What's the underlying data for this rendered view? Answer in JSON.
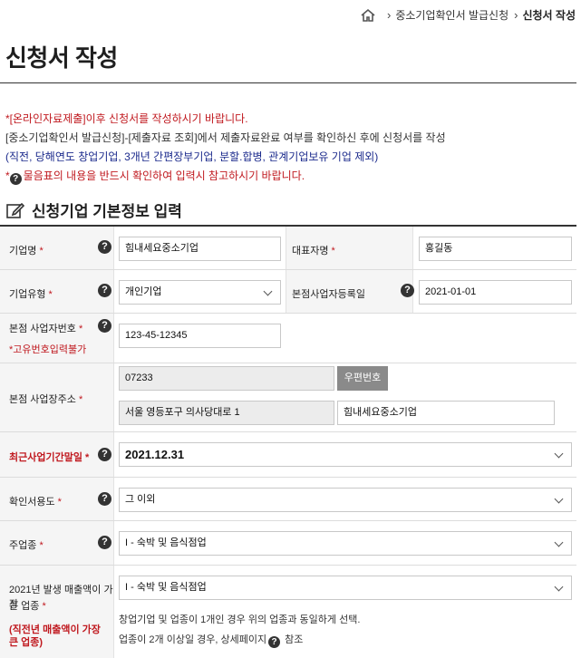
{
  "breadcrumb": {
    "items": [
      "중소기업확인서 발급신청",
      "신청서 작성"
    ]
  },
  "page": {
    "title": "신청서 작성"
  },
  "notices": {
    "line1": "*[온라인자료제출]이후 신청서를 작성하시기 바랍니다.",
    "line2": "[중소기업확인서 발급신청]-[제출자료 조회]에서 제출자료완료 여부를 확인하신 후에 신청서를 작성",
    "line3": "(직전, 당해연도 창업기업, 3개년 간편장부기업, 분할.합병, 관계기업보유 기업 제외)",
    "line4_prefix": "*",
    "line4": "물음표의 내용을 반드시 확인하여 입력시 참고하시기 바랍니다."
  },
  "section": {
    "title": "신청기업 기본정보 입력"
  },
  "form": {
    "company_name": {
      "label": "기업명",
      "value": "힘내세요중소기업"
    },
    "ceo": {
      "label": "대표자명",
      "value": "홍길동"
    },
    "company_type": {
      "label": "기업유형",
      "value": "개인기업"
    },
    "hq_reg_date": {
      "label": "본점사업자등록일",
      "value": "2021-01-01"
    },
    "hq_biz_no": {
      "label": "본점 사업자번호",
      "sub": "*고유번호입력불가",
      "value": "123-45-12345"
    },
    "hq_address": {
      "label": "본점 사업장주소",
      "zip": "07233",
      "zip_button": "우편번호",
      "address1": "서울 영등포구 의사당대로 1",
      "address2": "힘내세요중소기업"
    },
    "fiscal_end": {
      "label": "최근사업기간말일",
      "value": "2021.12.31"
    },
    "purpose": {
      "label": "확인서용도",
      "value": "그 이외"
    },
    "main_industry": {
      "label": "주업종",
      "value": "I - 숙박 및 음식점업"
    },
    "largest_sales_industry": {
      "label_line1": "2021년  발생 매출액이 가장",
      "label_line2": "큰 업종",
      "sub_line1": "(직전년 매출액이 가장",
      "sub_line2": "큰 업종)",
      "value": "I - 숙박 및 음식점업",
      "note1": "창업기업 및 업종이 1개인 경우 위의 업종과 동일하게 선택.",
      "note2": "업종이 2개 이상일 경우, 상세페이지",
      "note2_suffix": "참조"
    },
    "required_mark": "*"
  },
  "colors": {
    "required": "#c0191f",
    "navy": "#1b2a8c",
    "button": "#8a8a8a"
  },
  "icons": [
    "home-icon",
    "edit-icon",
    "help-icon",
    "chevron-down-icon"
  ]
}
